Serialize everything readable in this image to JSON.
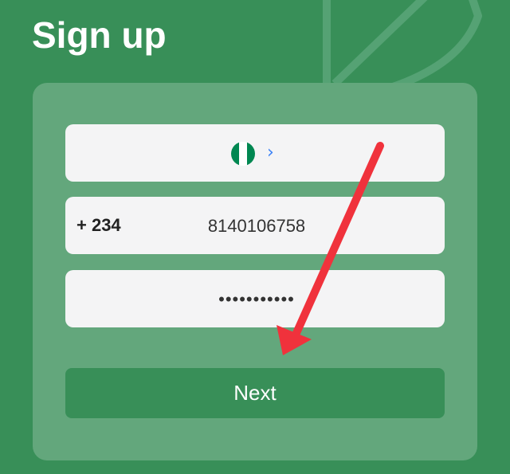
{
  "header": {
    "title": "Sign up"
  },
  "form": {
    "country": {
      "flag_icon": "nigeria-flag-icon",
      "chevron_icon": "chevron-right-icon",
      "flag_colors": [
        "#008751",
        "#ffffff",
        "#008751"
      ]
    },
    "phone": {
      "dial_code": "+ 234",
      "value": "8140106758"
    },
    "password": {
      "masked_value": "•••••••••••"
    },
    "next_label": "Next"
  },
  "annotation": {
    "icon": "red-arrow-annotation",
    "color": "#f0323c"
  },
  "colors": {
    "background": "#388f58",
    "card": "#63a77c",
    "field": "#f4f4f5",
    "button": "#388f58",
    "chevron": "#3b82f6"
  }
}
